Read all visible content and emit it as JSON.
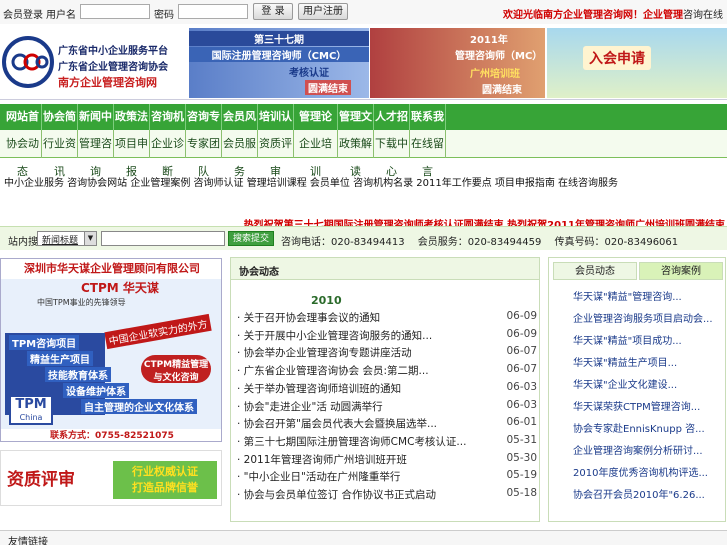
{
  "topbar": {
    "label1": "会员登录",
    "label2": "用户名",
    "label3": "密码",
    "login_btn": "登 录",
    "register_btn": "用户注册",
    "notice_red": "欢迎光临南方企业管理咨询网！企业管理",
    "notice_black": "咨询在线"
  },
  "banner": {
    "logo_line1": "广东省中小企业服务平台",
    "logo_line2": "广东省企业管理咨询协会",
    "logo_line3": "南方企业管理咨询网",
    "panel1_title": "第三十七期",
    "panel1_sub": "国际注册管理咨询师（CMC）",
    "panel1_note": "考核认证",
    "panel1_badge": "圆满结束",
    "panel2_year": "2011年",
    "panel2_title": "管理咨询师（MC）",
    "panel2_note": "广州培训班",
    "panel2_badge": "圆满结束",
    "panel3_btn": "入会申请"
  },
  "nav1": [
    "网站首页",
    "协会简介",
    "新闻中心",
    "政策法规",
    "咨询机构",
    "咨询专家",
    "会员风采",
    "培训认证",
    "管理论坛",
    "管理文库",
    "人才招聘",
    "联系我们"
  ],
  "nav2": [
    "协会动态",
    "行业资讯",
    "管理咨询",
    "项目申报",
    "企业诊断",
    "专家团队",
    "会员服务",
    "资质评审",
    "企业培训",
    "政策解读",
    "下载中心",
    "在线留言"
  ],
  "links_text": "中小企业服务 咨询协会网站 企业管理案例 咨询师认证 管理培训课程 会员单位 咨询机构名录 2011年工作要点 项目申报指南 在线咨询服务",
  "marquee": "热烈祝贺第三十七期国际注册管理咨询师考核认证圆满结束 热烈祝贺2011年管理咨询师广州培训班圆满结束",
  "search": {
    "label": "站内搜索",
    "select_value": "新闻标题",
    "button": "搜索提交",
    "phone_text": "咨询电话：020-83494413 　会员服务：020-83494459 　传真号码：020-83496061"
  },
  "ad1": {
    "company": "深圳市华天谋企业管理顾问有限公司",
    "brand": "CTPM 华天谋",
    "slogan": "中国TPM事业的先锋领导",
    "banner": "中国企业软实力的外方",
    "items": [
      "TPM咨询项目",
      "精益生产项目",
      "技能教育体系",
      "设备维护体系",
      "自主管理的企业文化体系"
    ],
    "badge": "CTPM精益管理与文化咨询",
    "tpm": "TPM",
    "china": "China",
    "contact": "联系方式：0755-82521075"
  },
  "ad2": {
    "title": "资质评审",
    "line1": "行业权威认证",
    "line2": "打造品牌信誉"
  },
  "news": {
    "heading": "协会动态",
    "year": "2010",
    "rows": [
      {
        "title": "· 关于召开协会理事会议的通知",
        "date": "06-09"
      },
      {
        "title": "· 关于开展中小企业管理咨询服务的通知...",
        "date": "06-09"
      },
      {
        "title": "· 协会举办企业管理咨询专题讲座活动",
        "date": "06-07"
      },
      {
        "title": "· 广东省企业管理咨询协会 会员:第二期...",
        "date": "06-07"
      },
      {
        "title": "· 关于举办管理咨询师培训班的通知",
        "date": "06-03"
      },
      {
        "title": "· 协会\"走进企业\"活 动圆满举行",
        "date": "06-03"
      },
      {
        "title": "· 协会召开第\"届会员代表大会暨换届选举...",
        "date": "06-01"
      },
      {
        "title": "· 第三十七期国际注册管理咨询师CMC考核认证...",
        "date": "05-31"
      },
      {
        "title": "· 2011年管理咨询师广州培训班开班",
        "date": "05-30"
      },
      {
        "title": "· \"中小企业日\"活动在广州隆重举行",
        "date": "05-19"
      },
      {
        "title": "· 协会与会员单位签订 合作协议书正式启动",
        "date": "05-18"
      }
    ]
  },
  "right": {
    "tab1": "会员动态",
    "tab2": "咨询案例",
    "rows": [
      "华天谋\"精益\"管理咨询...",
      "企业管理咨询服务项目启动会...",
      "华天谋\"精益\"项目成功...",
      "华天谋\"精益生产项目...",
      "华天谋\"企业文化建设...",
      "华天谋荣获CTPM管理咨询...",
      "协会专家赴EnnisKnupp 咨...",
      "企业管理咨询案例分析研讨...",
      "2010年度优秀咨询机构评选...",
      "协会召开会员2010年\"6.26..."
    ]
  },
  "bottom": {
    "label": "友情链接"
  },
  "colors": {
    "nav_green": "#37a437",
    "notice_red": "#d00000",
    "accent_blue": "#1a3a8a"
  }
}
